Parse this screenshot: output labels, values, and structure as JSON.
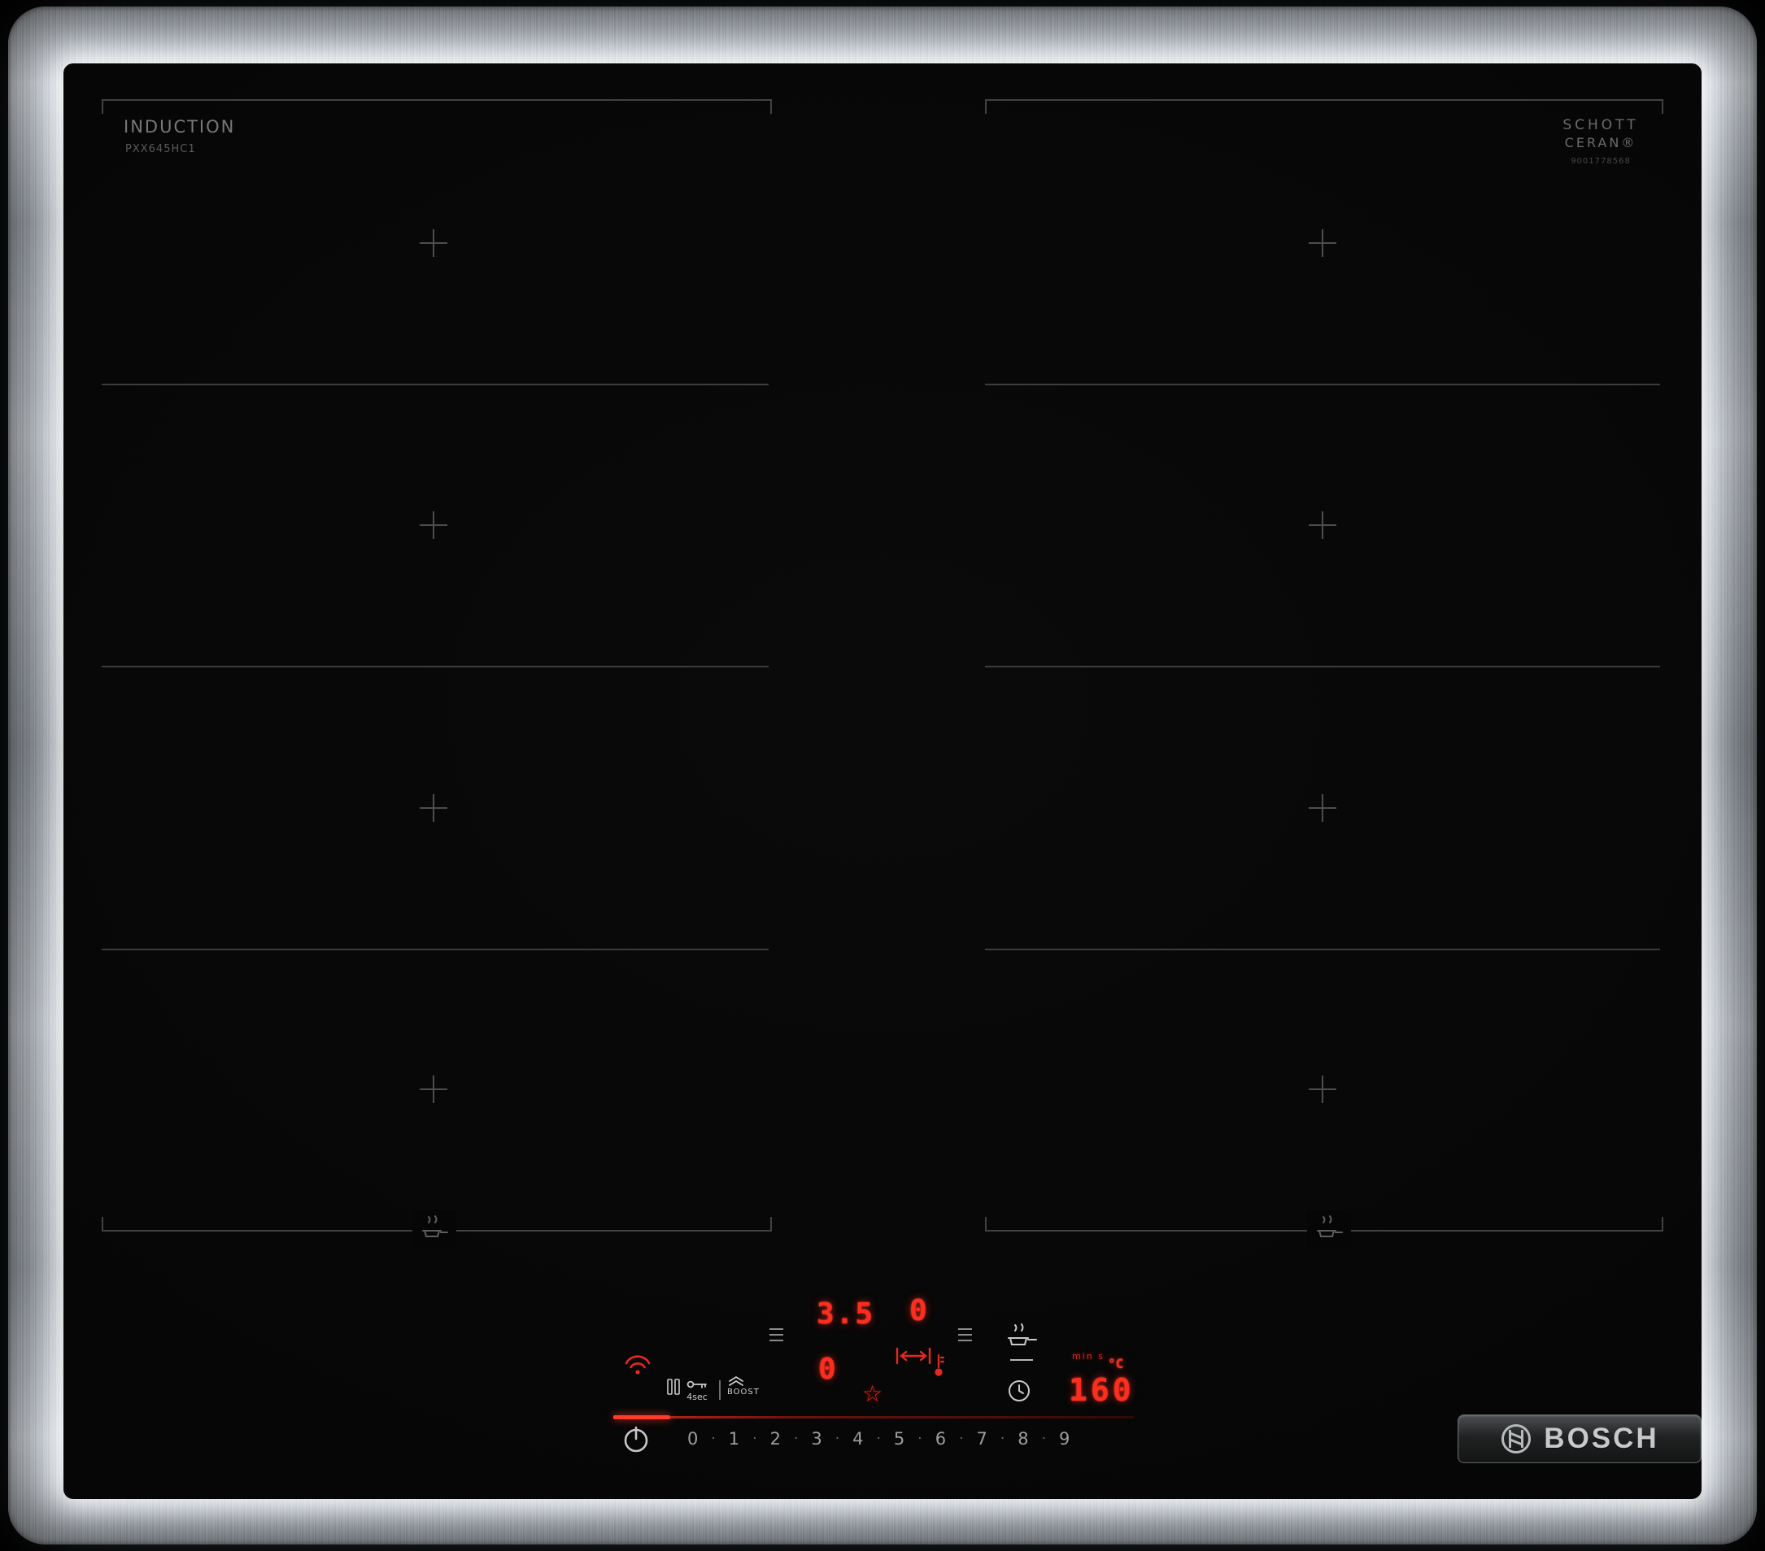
{
  "appliance": {
    "type_label": "INDUCTION",
    "model": "PXX645HC1",
    "glass_brand_line1": "SCHOTT",
    "glass_brand_line2": "CERAN®",
    "part_number": "9001778568",
    "brand": "BOSCH"
  },
  "panel": {
    "display_left_top": "3.5",
    "display_right_top": "0",
    "display_left_bottom": "0",
    "temp_display": "160",
    "temp_unit": "°C",
    "timer_unit_label": "min s",
    "lock_hold_label": "4sec",
    "boost_label": "BOOST",
    "star_icon_glyph": "☆",
    "level_separator": "·",
    "power_levels": [
      "0",
      "1",
      "2",
      "3",
      "4",
      "5",
      "6",
      "7",
      "8",
      "9"
    ]
  },
  "colors": {
    "led_red": "#ff2d1e",
    "marking_gray": "#4c4c4c",
    "icon_white": "#cccccc",
    "steel": "#b0b4b8"
  }
}
